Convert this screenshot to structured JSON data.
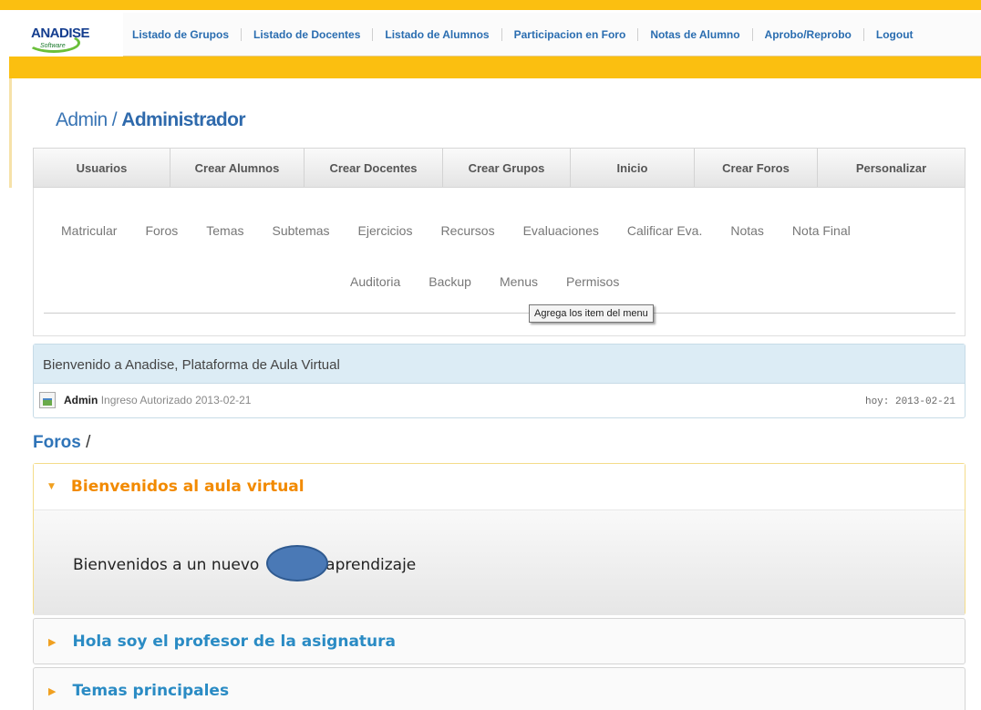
{
  "brand": {
    "logo_text": "ANADISE",
    "logo_sub": "Software"
  },
  "top_nav": [
    "Listado de Grupos",
    "Listado de Docentes",
    "Listado de Alumnos",
    "Participacion en Foro",
    "Notas de Alumno",
    "Aprobo/Reprobo",
    "Logout"
  ],
  "page_title": {
    "role": "Admin /",
    "name": "Administrador"
  },
  "main_tabs": [
    "Usuarios",
    "Crear Alumnos",
    "Crear Docentes",
    "Crear Grupos",
    "Inicio",
    "Crear Foros",
    "Personalizar"
  ],
  "sub_menu_row1": [
    "Matricular",
    "Foros",
    "Temas",
    "Subtemas",
    "Ejercicios",
    "Recursos",
    "Evaluaciones",
    "Calificar Eva.",
    "Notas",
    "Nota Final"
  ],
  "sub_menu_row2": [
    "Auditoria",
    "Backup",
    "Menus",
    "Permisos"
  ],
  "tooltip": "Agrega los item del menu",
  "welcome": {
    "title": "Bienvenido a Anadise, Plataforma de Aula Virtual",
    "user": "Admin",
    "login_status": "Ingreso Autorizado 2013-02-21",
    "today": "hoy: 2013-02-21"
  },
  "foros": {
    "title": "Foros",
    "separator": "/",
    "items": [
      {
        "title": "Bienvenidos al aula virtual",
        "expanded": true,
        "body_before": "Bienvenidos a un nuevo",
        "body_after": "aprendizaje"
      },
      {
        "title": "Hola soy el profesor de la asignatura",
        "expanded": false
      },
      {
        "title": "Temas principales",
        "expanded": false
      }
    ]
  },
  "colors": {
    "header_orange": "#fbbf10",
    "link_blue": "#2a6db0",
    "expanded_orange": "#f28a00"
  }
}
